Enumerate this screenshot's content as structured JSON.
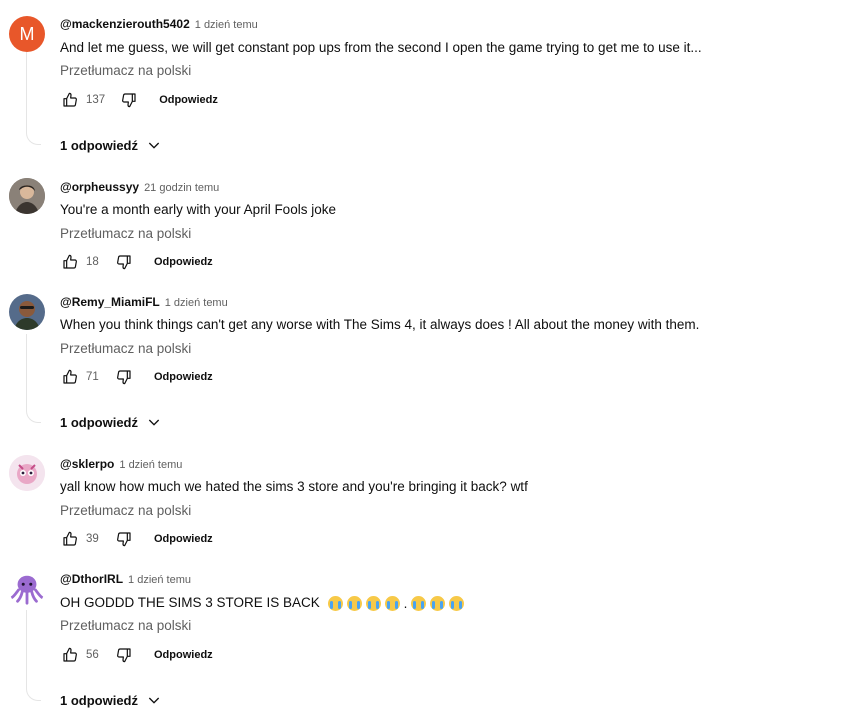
{
  "translate_label": "Przetłumacz na polski",
  "reply_label": "Odpowiedz",
  "comments": [
    {
      "author": "@mackenzierouth5402",
      "time": "1 dzień temu",
      "text": "And let me guess, we will get constant pop ups from the second I open the game trying to get me to use it...",
      "likes": "137",
      "replies": "1 odpowiedź",
      "avatar_letter": "M",
      "avatar_color": "#e8572a"
    },
    {
      "author": "@orpheussyy",
      "time": "21 godzin temu",
      "text": "You're a month early with your April Fools joke",
      "likes": "18"
    },
    {
      "author": "@Remy_MiamiFL",
      "time": "1 dzień temu",
      "text": "When you think things can't get any worse with The Sims 4, it always does ! All about the money with them.",
      "likes": "71",
      "replies": "1 odpowiedź"
    },
    {
      "author": "@sklerpo",
      "time": "1 dzień temu",
      "text": "yall know how much we hated the sims 3 store and you're bringing it back? wtf",
      "likes": "39"
    },
    {
      "author": "@DthorIRL",
      "time": "1 dzień temu",
      "text": "OH GODDD THE SIMS 3 STORE IS BACK",
      "likes": "56",
      "replies": "1 odpowiedź",
      "emoji": "loudly-crying-face"
    }
  ]
}
